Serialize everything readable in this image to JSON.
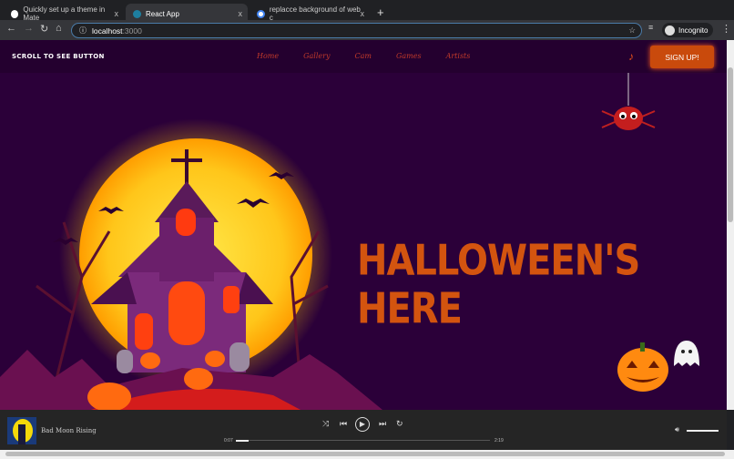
{
  "browser": {
    "tabs": [
      {
        "title": "Quickly set up a theme in Mate",
        "icon": "medium-icon"
      },
      {
        "title": "React App",
        "icon": "react-icon",
        "active": true
      },
      {
        "title": "replacce background of web c",
        "icon": "google-icon"
      }
    ],
    "new_tab": "+",
    "close": "x",
    "url_host": "localhost",
    "url_port": ":3000",
    "profile": "Incognito"
  },
  "header": {
    "brand": "SCROLL TO SEE BUTTON",
    "menu": [
      "Home",
      "Gallery",
      "Cam",
      "Games",
      "Artists"
    ],
    "signup": "SIGN UP!"
  },
  "hero": {
    "title": "HALLOWEEN'S HERE"
  },
  "player": {
    "song": "Bad Moon Rising",
    "current_time": "0:07",
    "duration": "2:19",
    "progress_percent": 5,
    "volume_percent": 100
  },
  "colors": {
    "background": "#2b0039",
    "accent": "#d3540f",
    "moon": "#ffd21a"
  }
}
